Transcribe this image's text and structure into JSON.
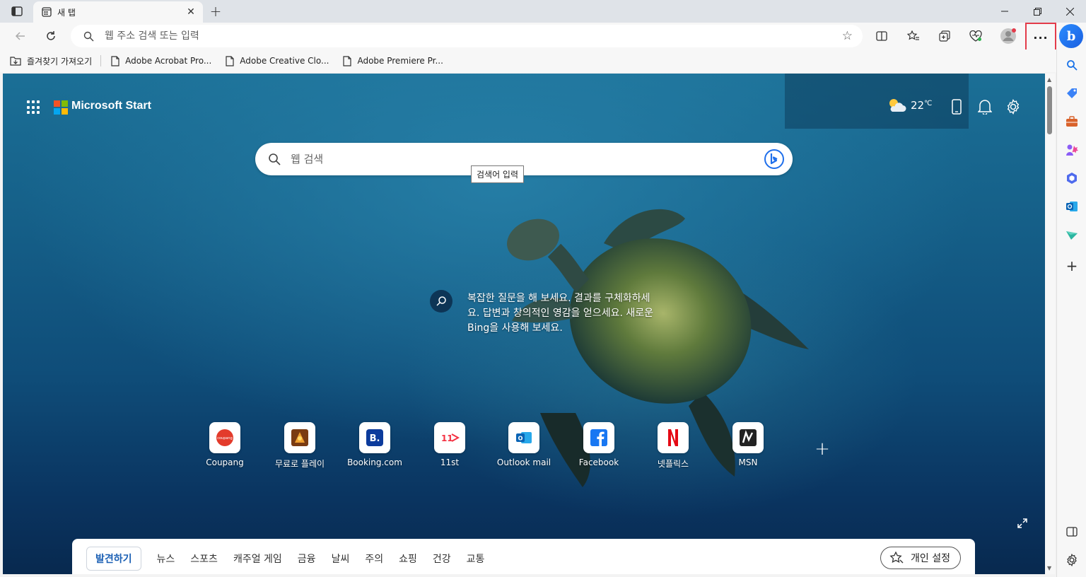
{
  "tab": {
    "title": "새 탭"
  },
  "toolbar": {
    "address_placeholder": "웹 주소 검색 또는 입력",
    "more_label": "···"
  },
  "favorites": [
    {
      "label": "즐겨찾기 가져오기",
      "icon": "import-favorites-icon"
    },
    {
      "label": "Adobe Acrobat Pro...",
      "icon": "page-icon"
    },
    {
      "label": "Adobe Creative Clo...",
      "icon": "page-icon"
    },
    {
      "label": "Adobe Premiere Pr...",
      "icon": "page-icon"
    }
  ],
  "newtab": {
    "brand": "Microsoft Start",
    "weather_temp": "22",
    "weather_unit": "℃",
    "search_placeholder": "웹 검색",
    "tooltip": "검색어 입력",
    "bing_prompt": "복잡한 질문을 해 보세요. 결과를 구체화하세요. 답변과 창의적인 영감을 얻으세요. 새로운 Bing을 사용해 보세요.",
    "tiles": [
      {
        "label": "Coupang",
        "icon": "coupang-icon"
      },
      {
        "label": "무료로 플레이",
        "icon": "game-icon"
      },
      {
        "label": "Booking.com",
        "icon": "booking-icon"
      },
      {
        "label": "11st",
        "icon": "11st-icon"
      },
      {
        "label": "Outlook mail",
        "icon": "outlook-icon"
      },
      {
        "label": "Facebook",
        "icon": "facebook-icon"
      },
      {
        "label": "넷플릭스",
        "icon": "netflix-icon"
      },
      {
        "label": "MSN",
        "icon": "msn-icon"
      }
    ],
    "feed_nav": [
      "발견하기",
      "뉴스",
      "스포츠",
      "캐주얼 게임",
      "금융",
      "날씨",
      "주의",
      "쇼핑",
      "건강",
      "교통"
    ],
    "personalize": "개인 설정"
  },
  "colors": {
    "accent": "#1a5fb4",
    "highlight_border": "#e33b4a",
    "ocean_top": "#1b6f96",
    "ocean_bottom": "#08294f"
  }
}
